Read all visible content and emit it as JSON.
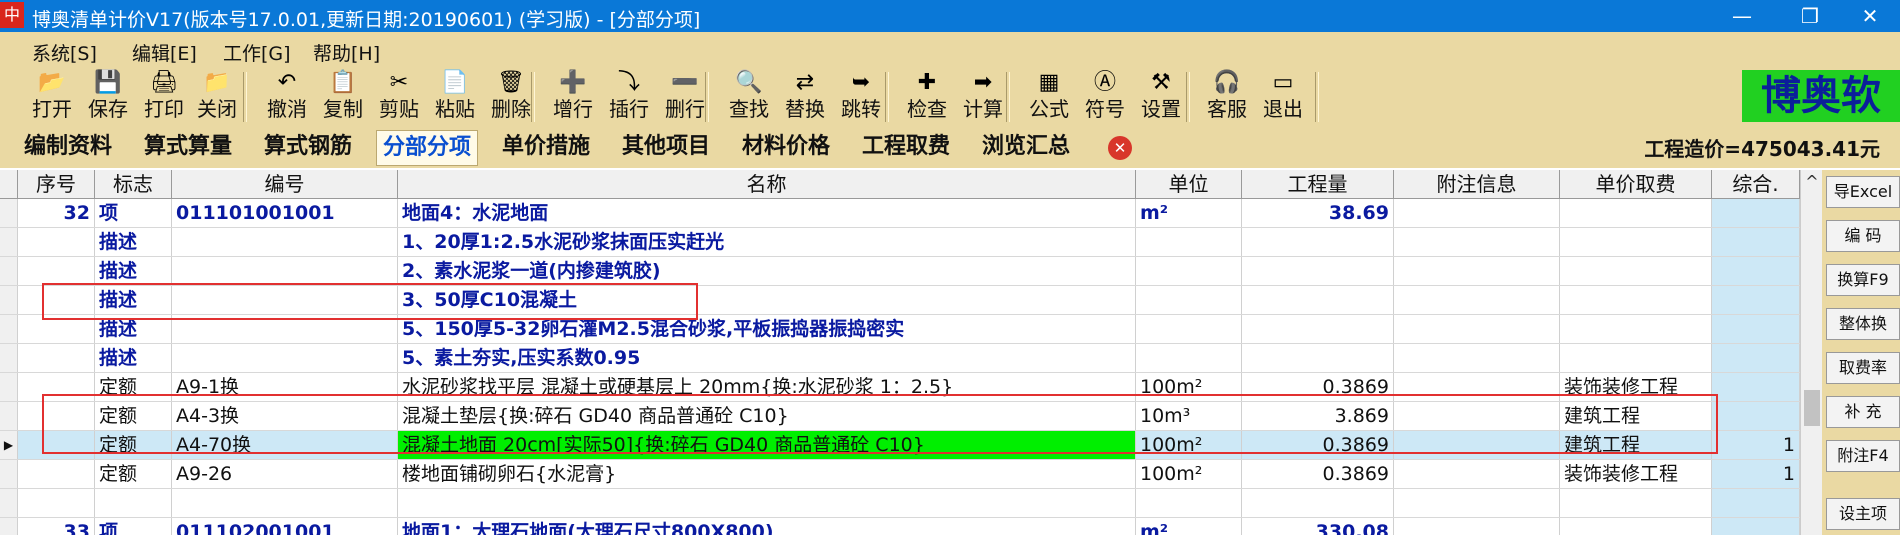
{
  "window": {
    "app_icon": "中",
    "title": "博奥清单计价V17(版本号17.0.01,更新日期:20190601) (学习版) - [分部分项]",
    "minimize": "—",
    "maximize": "❐",
    "close": "✕"
  },
  "menu": [
    "系统[S]",
    "编辑[E]",
    "工作[G]",
    "帮助[H]"
  ],
  "toolbar": [
    {
      "label": "打开",
      "icon": "folder-open-icon",
      "glyph": "📂"
    },
    {
      "label": "保存",
      "icon": "save-icon",
      "glyph": "💾"
    },
    {
      "label": "打印",
      "icon": "print-icon",
      "glyph": "🖨"
    },
    {
      "label": "关闭",
      "icon": "close-folder-icon",
      "glyph": "📁"
    },
    {
      "label": "撤消",
      "icon": "undo-icon",
      "glyph": "↶"
    },
    {
      "label": "复制",
      "icon": "copy-icon",
      "glyph": "📋"
    },
    {
      "label": "剪贴",
      "icon": "cut-icon",
      "glyph": "✂"
    },
    {
      "label": "粘贴",
      "icon": "paste-icon",
      "glyph": "📄"
    },
    {
      "label": "删除",
      "icon": "delete-icon",
      "glyph": "🗑"
    },
    {
      "label": "增行",
      "icon": "insert-row-icon",
      "glyph": "➕"
    },
    {
      "label": "插行",
      "icon": "insert-line-icon",
      "glyph": "⤵"
    },
    {
      "label": "删行",
      "icon": "delete-row-icon",
      "glyph": "➖"
    },
    {
      "label": "查找",
      "icon": "find-icon",
      "glyph": "🔍"
    },
    {
      "label": "替换",
      "icon": "replace-icon",
      "glyph": "⇄"
    },
    {
      "label": "跳转",
      "icon": "jump-icon",
      "glyph": "➥"
    },
    {
      "label": "检查",
      "icon": "check-icon",
      "glyph": "✚"
    },
    {
      "label": "计算",
      "icon": "calculate-icon",
      "glyph": "➡"
    },
    {
      "label": "公式",
      "icon": "formula-icon",
      "glyph": "▦"
    },
    {
      "label": "符号",
      "icon": "symbol-icon",
      "glyph": "Ⓐ"
    },
    {
      "label": "设置",
      "icon": "settings-icon",
      "glyph": "⚒"
    },
    {
      "label": "客服",
      "icon": "headset-icon",
      "glyph": "🎧"
    },
    {
      "label": "退出",
      "icon": "exit-icon",
      "glyph": "▭"
    }
  ],
  "brand": "博奥软件",
  "tabs": [
    "编制资料",
    "算式算量",
    "算式钢筋",
    "分部分项",
    "单价措施",
    "其他项目",
    "材料价格",
    "工程取费",
    "浏览汇总"
  ],
  "active_tab": "分部分项",
  "close_tab": "✕",
  "total": "工程造价=475043.41元",
  "columns": [
    "序号",
    "标志",
    "编号",
    "名称",
    "单位",
    "工程量",
    "附注信息",
    "单价取费",
    "综合."
  ],
  "rows": [
    {
      "seq": "32",
      "flag": "项",
      "code": "011101001001",
      "name": "地面4：水泥地面",
      "unit": "m²",
      "qty": "38.69",
      "note": "",
      "fee": "",
      "total": "",
      "style": "item"
    },
    {
      "seq": "",
      "flag": "描述",
      "code": "",
      "name": "1、20厚1:2.5水泥砂浆抹面压实赶光",
      "unit": "",
      "qty": "",
      "note": "",
      "fee": "",
      "total": "",
      "style": "desc"
    },
    {
      "seq": "",
      "flag": "描述",
      "code": "",
      "name": "2、素水泥浆一道(内掺建筑胶)",
      "unit": "",
      "qty": "",
      "note": "",
      "fee": "",
      "total": "",
      "style": "desc"
    },
    {
      "seq": "",
      "flag": "描述",
      "code": "",
      "name": "3、50厚C10混凝土",
      "unit": "",
      "qty": "",
      "note": "",
      "fee": "",
      "total": "",
      "style": "desc"
    },
    {
      "seq": "",
      "flag": "描述",
      "code": "",
      "name": "5、150厚5-32卵石灌M2.5混合砂浆,平板振捣器振捣密实",
      "unit": "",
      "qty": "",
      "note": "",
      "fee": "",
      "total": "",
      "style": "desc"
    },
    {
      "seq": "",
      "flag": "描述",
      "code": "",
      "name": "5、素土夯实,压实系数0.95",
      "unit": "",
      "qty": "",
      "note": "",
      "fee": "",
      "total": "",
      "style": "desc"
    },
    {
      "seq": "",
      "flag": "定额",
      "code": "A9-1换",
      "name": "水泥砂浆找平层 混凝土或硬基层上 20mm{换:水泥砂浆 1：2.5}",
      "unit": "100m²",
      "qty": "0.3869",
      "note": "",
      "fee": "装饰装修工程",
      "total": "",
      "style": "quota"
    },
    {
      "seq": "",
      "flag": "定额",
      "code": "A4-3换",
      "name": "混凝土垫层{换:碎石 GD40  商品普通砼  C10}",
      "unit": "10m³",
      "qty": "3.869",
      "note": "",
      "fee": "建筑工程",
      "total": "",
      "style": "quota"
    },
    {
      "seq": "",
      "flag": "定额",
      "code": "A4-70换",
      "name": "混凝土地面 20cm[实际50]{换:碎石 GD40  商品普通砼  C10}",
      "unit": "100m²",
      "qty": "0.3869",
      "note": "",
      "fee": "建筑工程",
      "total": "1",
      "style": "selected"
    },
    {
      "seq": "",
      "flag": "定额",
      "code": "A9-26",
      "name": "楼地面铺砌卵石{水泥膏}",
      "unit": "100m²",
      "qty": "0.3869",
      "note": "",
      "fee": "装饰装修工程",
      "total": "1",
      "style": "quota"
    },
    {
      "seq": "",
      "flag": "",
      "code": "",
      "name": "",
      "unit": "",
      "qty": "",
      "note": "",
      "fee": "",
      "total": "",
      "style": "blank"
    },
    {
      "seq": "33",
      "flag": "项",
      "code": "011102001001",
      "name": "地面1：大理石地面(大理石尺寸800X800)",
      "unit": "m²",
      "qty": "330.08",
      "note": "",
      "fee": "",
      "total": "",
      "style": "item"
    }
  ],
  "scroll_up": "^",
  "side_buttons": [
    "导Excel",
    "编 码",
    "换算F9",
    "整体换",
    "取费率",
    "补 充",
    "附注F4",
    "设主项"
  ]
}
